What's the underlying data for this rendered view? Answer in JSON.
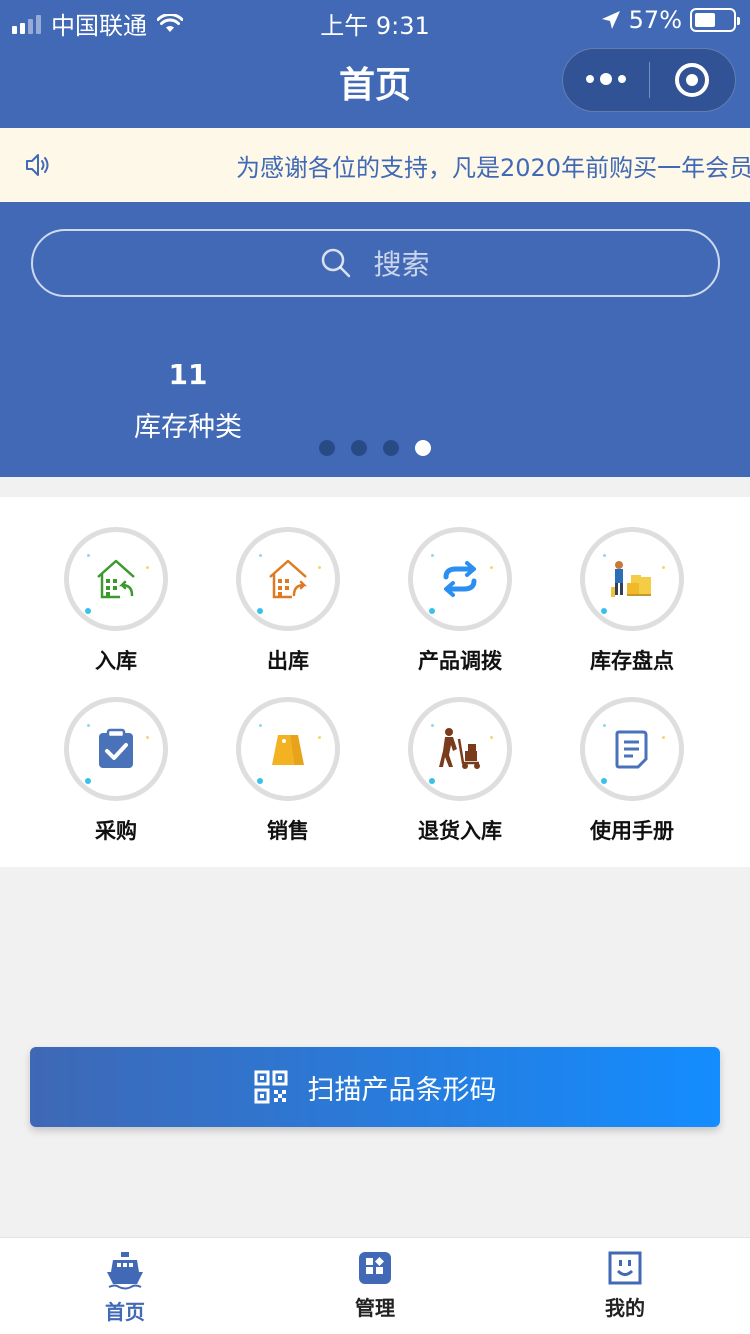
{
  "status_bar": {
    "carrier": "中国联通",
    "time": "上午 9:31",
    "battery": "57%"
  },
  "nav": {
    "title": "首页"
  },
  "notice": {
    "text": "为感谢各位的支持，凡是2020年前购买一年会员"
  },
  "search": {
    "placeholder": "搜索"
  },
  "banner": {
    "stat_value": "11",
    "stat_label": "库存种类",
    "slides": 4,
    "active_slide": 4
  },
  "grid": {
    "items": [
      {
        "label": "入库",
        "icon": "warehouse-in-icon",
        "color": "#3a9a2e"
      },
      {
        "label": "出库",
        "icon": "warehouse-out-icon",
        "color": "#e07a22"
      },
      {
        "label": "产品调拨",
        "icon": "transfer-icon",
        "color": "#2a8ff0"
      },
      {
        "label": "库存盘点",
        "icon": "inventory-check-icon",
        "color": "#f0b92a"
      },
      {
        "label": "采购",
        "icon": "clipboard-check-icon",
        "color": "#4a72b9"
      },
      {
        "label": "销售",
        "icon": "price-tag-icon",
        "color": "#f3b222"
      },
      {
        "label": "退货入库",
        "icon": "hand-truck-icon",
        "color": "#7a3b1c"
      },
      {
        "label": "使用手册",
        "icon": "document-icon",
        "color": "#4a72b9"
      }
    ]
  },
  "scan_button": {
    "label": "扫描产品条形码"
  },
  "tabbar": {
    "tabs": [
      {
        "label": "首页",
        "icon": "ship-icon"
      },
      {
        "label": "管理",
        "icon": "apps-icon"
      },
      {
        "label": "我的",
        "icon": "face-icon"
      }
    ],
    "active": "首页"
  },
  "colors": {
    "primary": "#4169b6",
    "notice_bg": "#fdf8e7",
    "scan_gradient_end": "#138dff"
  }
}
